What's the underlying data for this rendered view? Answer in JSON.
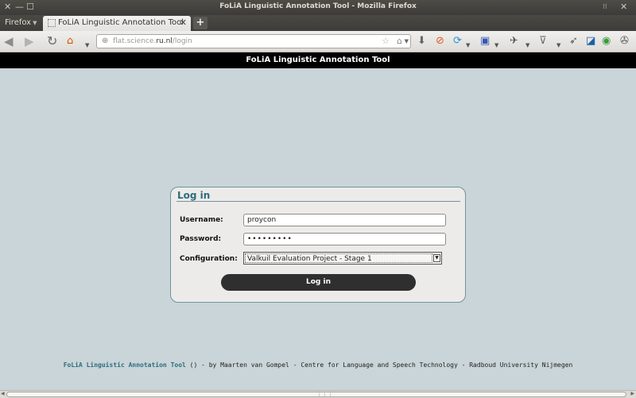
{
  "window": {
    "title": "FoLiA Linguistic Annotation Tool - Mozilla Firefox",
    "close": "✕",
    "minimize": "—",
    "maximize": "☐",
    "right_controls": "⁝⁝",
    "right_close": "✕"
  },
  "tabstrip": {
    "firefox_label": "Firefox",
    "tab_title": "FoLiA Linguistic Annotation Tool",
    "tab_close": "✕",
    "new_tab": "+"
  },
  "navbar": {
    "url_prefix": "flat.science.",
    "url_domain": "ru.nl",
    "url_path": "/login"
  },
  "page": {
    "header": "FoLiA Linguistic Annotation Tool",
    "login": {
      "title": "Log in",
      "username_label": "Username:",
      "username_value": "proycon",
      "password_label": "Password:",
      "password_value": "•••••••••",
      "configuration_label": "Configuration:",
      "configuration_value": "Valkuil Evaluation Project - Stage 1",
      "submit_label": "Log in"
    },
    "footer": {
      "link": "FoLiA Linguistic Annotation Tool",
      "text": " () - by Maarten van Gompel - Centre for Language and Speech Technology - Radboud University Nijmegen"
    }
  },
  "colors": {
    "page_bg": "#c9d5d8",
    "accent": "#2c6c7d",
    "header_bg": "#000000",
    "button_bg": "#2f2f2f"
  },
  "icons": [
    "close-icon",
    "minimize-icon",
    "maximize-icon",
    "back-icon",
    "forward-icon",
    "reload-icon",
    "home-icon",
    "bookmark-star-icon",
    "download-icon",
    "addon-icon",
    "sync-icon",
    "bookmark-icon",
    "share-icon",
    "pocket-icon",
    "send-icon",
    "extension-icon",
    "menu-icon"
  ]
}
